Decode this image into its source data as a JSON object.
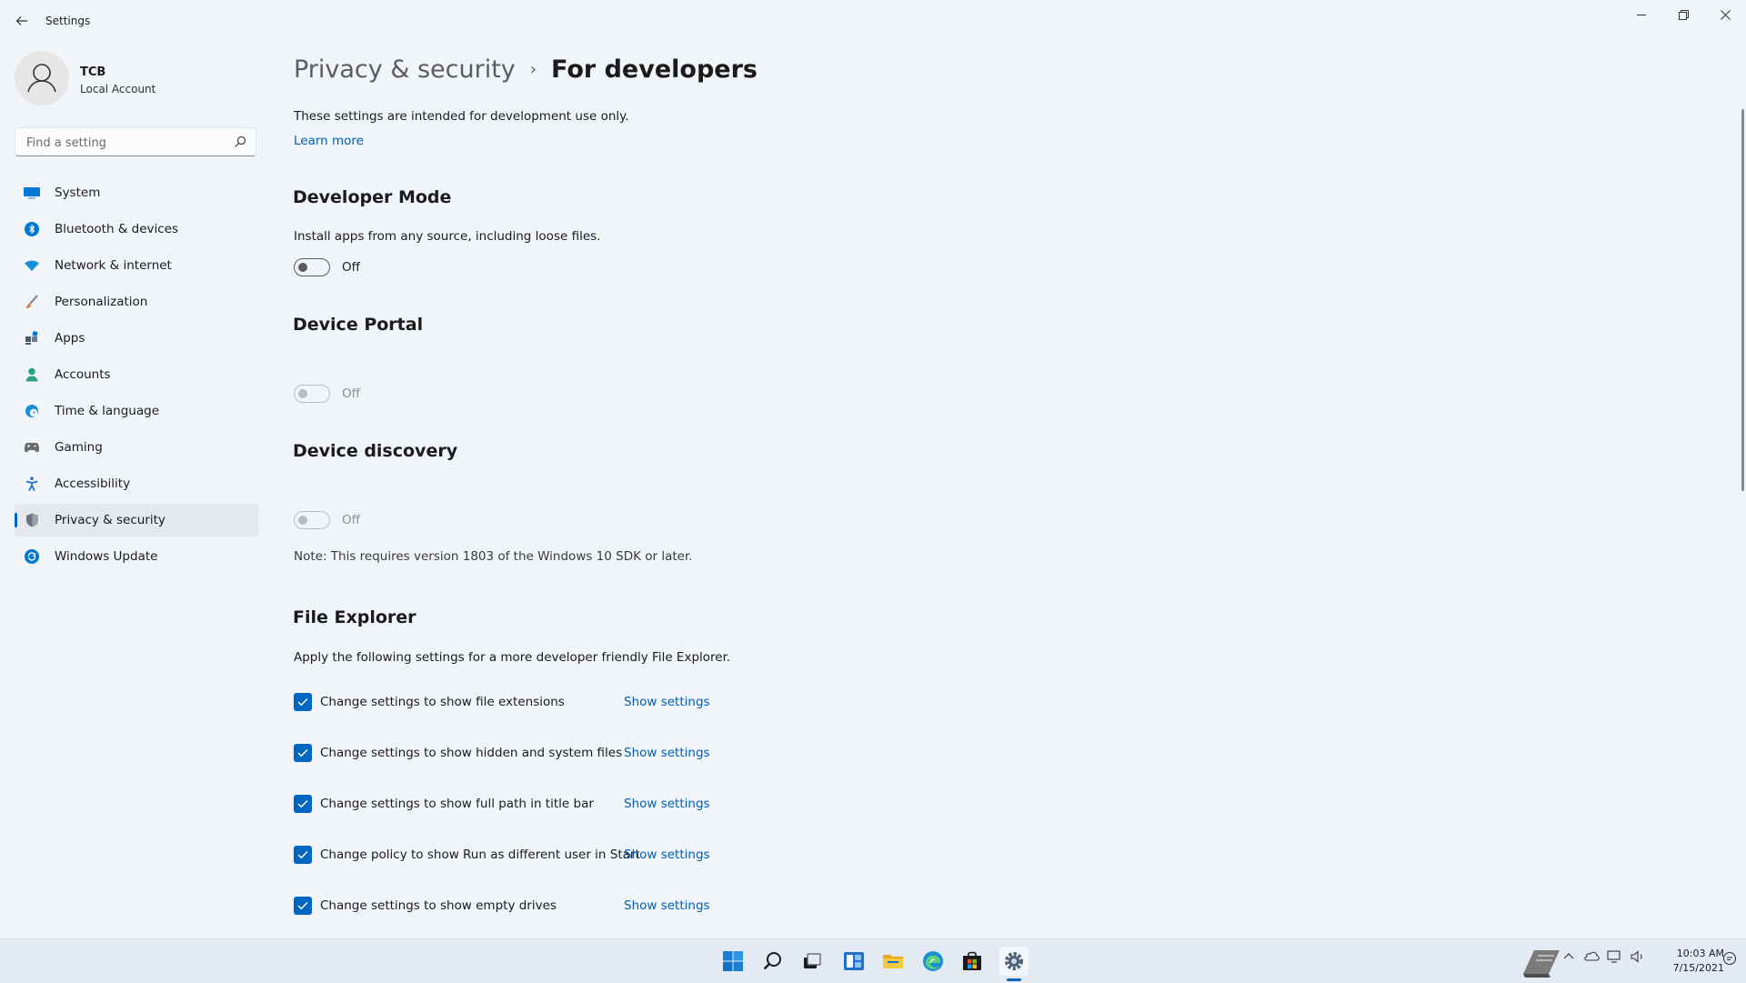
{
  "app": {
    "title": "Settings"
  },
  "user": {
    "name": "TCB",
    "account_type": "Local Account"
  },
  "search": {
    "placeholder": "Find a setting",
    "value": ""
  },
  "sidebar": {
    "items": [
      {
        "label": "System",
        "icon": "monitor-icon",
        "color": "#0078d4"
      },
      {
        "label": "Bluetooth & devices",
        "icon": "bluetooth-icon",
        "color": "#0078d4"
      },
      {
        "label": "Network & internet",
        "icon": "wifi-icon",
        "color": "#1b8fd6"
      },
      {
        "label": "Personalization",
        "icon": "brush-icon",
        "color": "#d67a3c"
      },
      {
        "label": "Apps",
        "icon": "apps-icon",
        "color": "#4b5a6e"
      },
      {
        "label": "Accounts",
        "icon": "person-icon",
        "color": "#2aa57c"
      },
      {
        "label": "Time & language",
        "icon": "globe-clock-icon",
        "color": "#1b8fd6"
      },
      {
        "label": "Gaming",
        "icon": "gamepad-icon",
        "color": "#6b6b6b"
      },
      {
        "label": "Accessibility",
        "icon": "accessibility-icon",
        "color": "#1b6fd6"
      },
      {
        "label": "Privacy & security",
        "icon": "shield-icon",
        "color": "#6b7280",
        "selected": true
      },
      {
        "label": "Windows Update",
        "icon": "update-icon",
        "color": "#0078d4"
      }
    ]
  },
  "breadcrumb": {
    "parent": "Privacy & security",
    "separator": "›",
    "current": "For developers"
  },
  "intro": {
    "text": "These settings are intended for development use only.",
    "link": "Learn more"
  },
  "developer_mode": {
    "heading": "Developer Mode",
    "description": "Install apps from any source, including loose files.",
    "toggle_state": "Off"
  },
  "device_portal": {
    "heading": "Device Portal",
    "toggle_state": "Off"
  },
  "device_discovery": {
    "heading": "Device discovery",
    "toggle_state": "Off",
    "note": "Note: This requires version 1803 of the Windows 10 SDK or later."
  },
  "file_explorer": {
    "heading": "File Explorer",
    "description": "Apply the following settings for a more developer friendly File Explorer.",
    "options": [
      {
        "label": "Change settings to show file extensions",
        "checked": true,
        "link": "Show settings"
      },
      {
        "label": "Change settings to show hidden and system files",
        "checked": true,
        "link": "Show settings"
      },
      {
        "label": "Change settings to show full path in title bar",
        "checked": true,
        "link": "Show settings"
      },
      {
        "label": "Change policy to show Run as different user in Start",
        "checked": true,
        "link": "Show settings"
      },
      {
        "label": "Change settings to show empty drives",
        "checked": true,
        "link": "Show settings"
      }
    ]
  },
  "taskbar": {
    "apps": [
      "start-icon",
      "search-icon",
      "task-view-icon",
      "widgets-icon",
      "file-explorer-icon",
      "edge-icon",
      "store-icon",
      "settings-icon"
    ],
    "clock": {
      "time": "10:03 AM",
      "date": "7/15/2021"
    }
  },
  "colors": {
    "accent": "#0067c0",
    "link": "#005fb8",
    "background": "#f1f4f9"
  }
}
